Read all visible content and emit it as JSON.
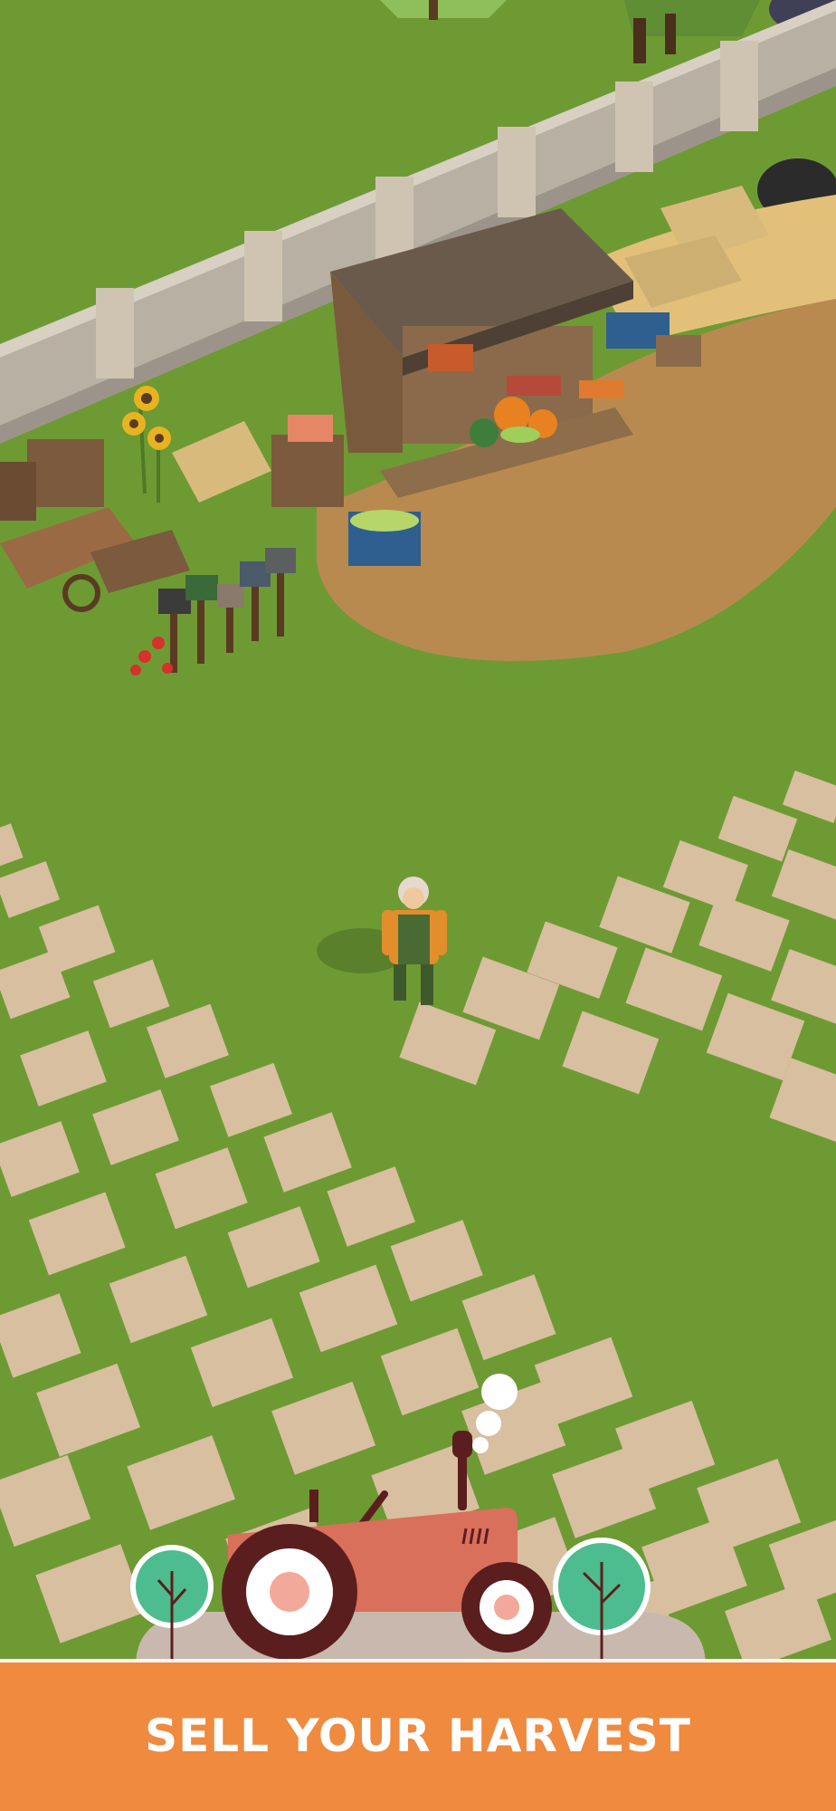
{
  "banner": {
    "title": "SELL YOUR HARVEST"
  },
  "colors": {
    "grass": "#6e9a34",
    "stone": "#d8bfa0",
    "dirt": "#b98a4f",
    "banner": "#ef8a3e",
    "tractor_body": "#d9705b",
    "tractor_tire": "#5b1e1e",
    "tree_green": "#4dbc8e"
  },
  "icons": {
    "tractor": "tractor-icon",
    "tree": "tree-icon",
    "smoke": "smoke-icon"
  }
}
